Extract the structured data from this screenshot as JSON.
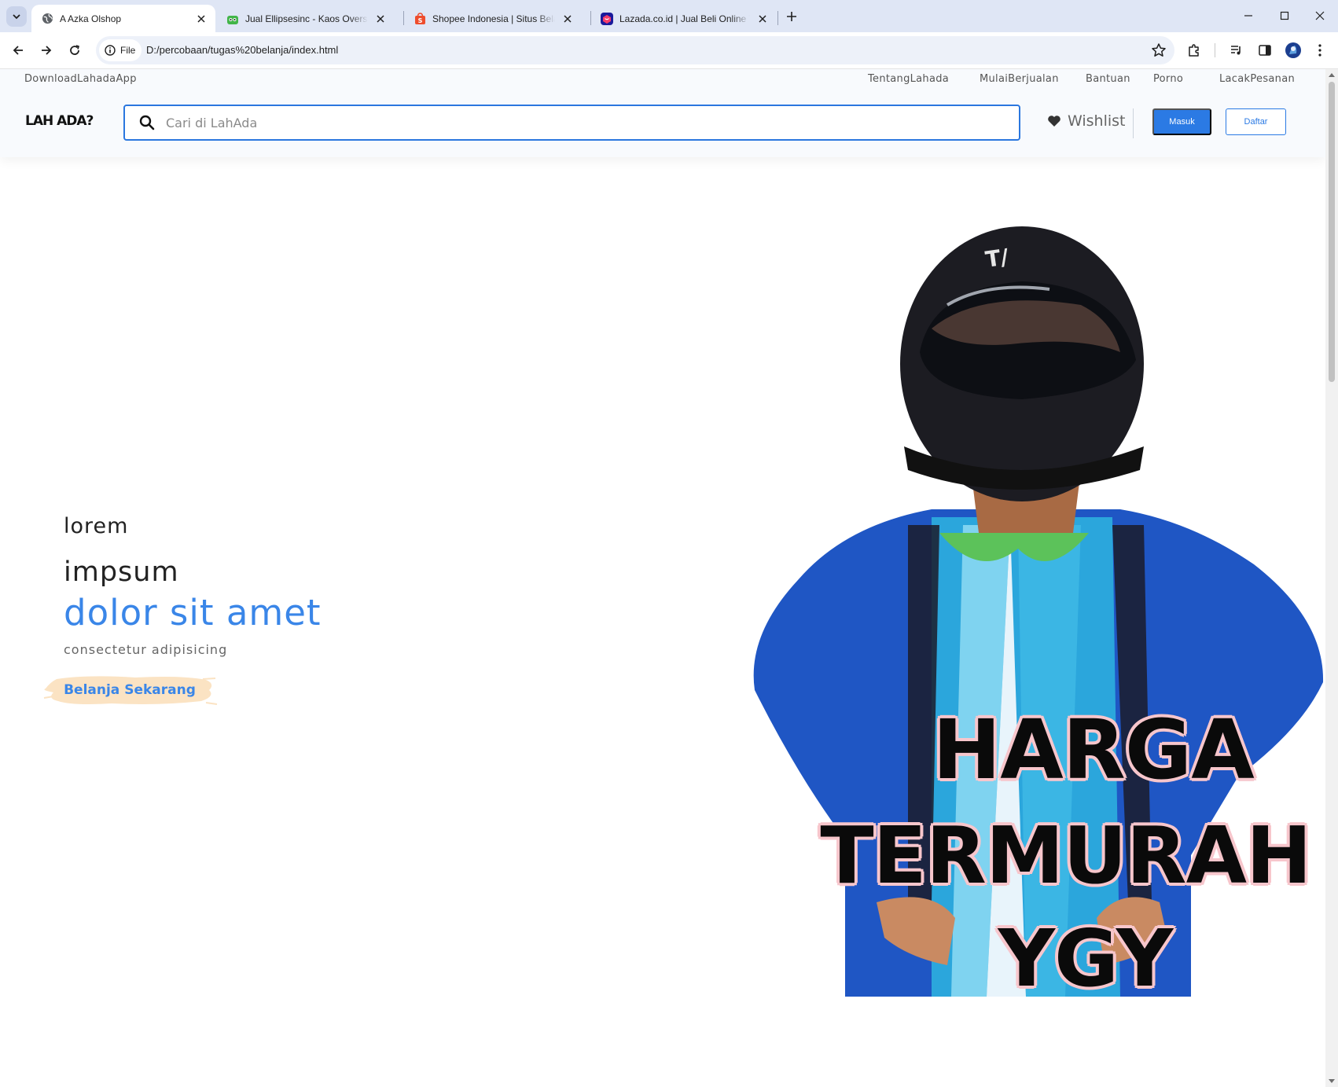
{
  "browser": {
    "tabs": [
      {
        "title": "A Azka Olshop",
        "active": true,
        "icon": "globe-icon"
      },
      {
        "title": "Jual Ellipsesinc - Kaos Oversize",
        "active": false,
        "icon": "tokopedia-icon"
      },
      {
        "title": "Shopee Indonesia | Situs Belanja",
        "active": false,
        "icon": "shopee-icon"
      },
      {
        "title": "Lazada.co.id | Jual Beli Online Te",
        "active": false,
        "icon": "lazada-icon"
      }
    ],
    "chip_label": "File",
    "url": "D:/percobaan/tugas%20belanja/index.html"
  },
  "site": {
    "topbar": {
      "download": "DownloadLahadaApp",
      "links": [
        "TentangLahada",
        "MulaiBerjualan",
        "Bantuan",
        "Porno",
        "LacakPesanan"
      ]
    },
    "logo": "LAH ADA?",
    "search": {
      "placeholder": "Cari di LahAda",
      "value": ""
    },
    "wishlist": "Wishlist",
    "login": "Masuk",
    "register": "Daftar"
  },
  "hero": {
    "line1": "lorem",
    "line2": "impsum",
    "line3": "dolor sit amet",
    "line4": "consectetur adipisicing",
    "cta": "Belanja Sekarang",
    "promo": [
      "HARGA",
      "TERMURAH",
      "YGY"
    ],
    "accent_color": "#3a86e8"
  }
}
